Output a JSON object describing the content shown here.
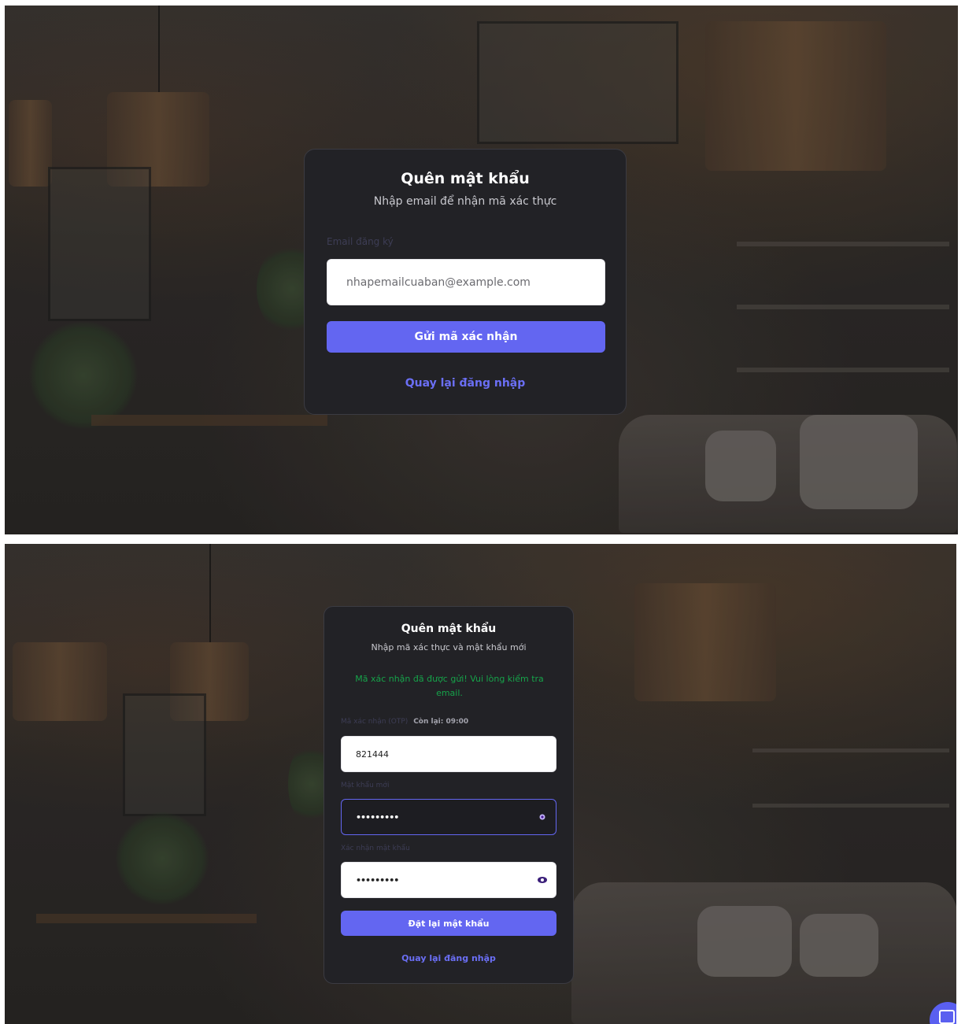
{
  "email_step": {
    "title": "Quên mật khẩu",
    "subtitle": "Nhập email để nhận mã xác thực",
    "email_label": "Email đăng ký",
    "email_placeholder": "nhapemailcuaban@example.com",
    "submit_label": "Gửi mã xác nhận",
    "back_link": "Quay lại đăng nhập"
  },
  "reset_step": {
    "title": "Quên mật khẩu",
    "subtitle": "Nhập mã xác thực và mật khẩu mới",
    "success_message": "Mã xác nhận đã được gửi! Vui lòng kiểm tra email.",
    "otp_label": "Mã xác nhận (OTP)",
    "otp_timer": "Còn lại: 09:00",
    "otp_value": "821444",
    "new_password_label": "Mật khẩu mới",
    "new_password_value": "•••••••••",
    "confirm_password_label": "Xác nhận mật khẩu",
    "confirm_password_value": "•••••••••",
    "submit_label": "Đặt lại mật khẩu",
    "back_link": "Quay lại đăng nhập"
  },
  "icons": {
    "eye": "eye-icon",
    "chat": "chat-icon"
  },
  "colors": {
    "accent": "#6366f1",
    "success": "#16a34a",
    "card_bg": "#222226"
  }
}
